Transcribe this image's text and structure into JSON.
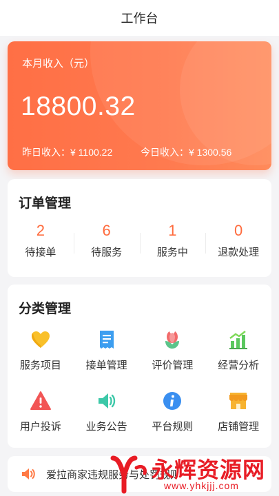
{
  "header": {
    "title": "工作台"
  },
  "income": {
    "label": "本月收入（元）",
    "amount": "18800.32",
    "yesterday": "昨日收入：¥ 1100.22",
    "today": "今日收入：¥ 1300.56"
  },
  "orders": {
    "title": "订单管理",
    "stats": [
      {
        "count": "2",
        "label": "待接单"
      },
      {
        "count": "6",
        "label": "待服务"
      },
      {
        "count": "1",
        "label": "服务中"
      },
      {
        "count": "0",
        "label": "退款处理"
      }
    ]
  },
  "categories": {
    "title": "分类管理",
    "items": [
      {
        "label": "服务项目",
        "icon": "heart-icon"
      },
      {
        "label": "接单管理",
        "icon": "receipt-icon"
      },
      {
        "label": "评价管理",
        "icon": "flower-icon"
      },
      {
        "label": "经营分析",
        "icon": "bar-chart-icon"
      },
      {
        "label": "用户投诉",
        "icon": "warning-icon"
      },
      {
        "label": "业务公告",
        "icon": "speaker-icon"
      },
      {
        "label": "平台规则",
        "icon": "info-icon"
      },
      {
        "label": "店铺管理",
        "icon": "store-icon"
      }
    ]
  },
  "notice": {
    "text": "爱拉商家违规服务与处罚规则"
  },
  "watermark": {
    "title": "永辉资源网",
    "url": "www.yhkjjj.com"
  },
  "colors": {
    "accent": "#ff6b3d",
    "card_gradient_start": "#ff6f45",
    "card_gradient_end": "#ff8a5a"
  }
}
